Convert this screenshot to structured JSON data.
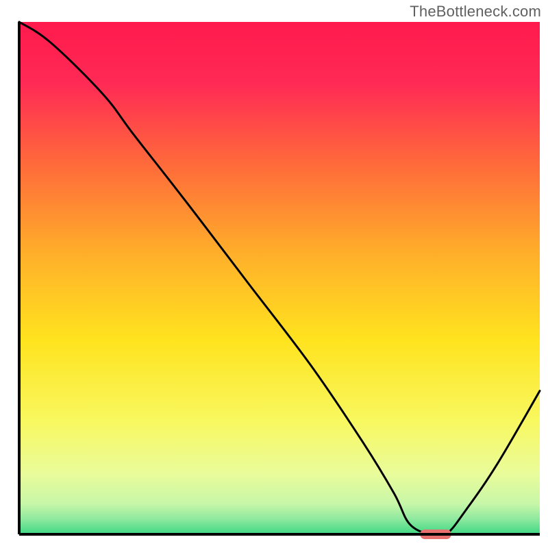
{
  "watermark": "TheBottleneck.com",
  "chart_data": {
    "type": "line",
    "title": "",
    "xlabel": "",
    "ylabel": "",
    "xlim": [
      0,
      100
    ],
    "ylim": [
      0,
      100
    ],
    "grid": false,
    "background_gradient": {
      "stops": [
        {
          "offset": 0.0,
          "color": "#ff1a4d"
        },
        {
          "offset": 0.12,
          "color": "#ff2a55"
        },
        {
          "offset": 0.28,
          "color": "#ff6b3a"
        },
        {
          "offset": 0.45,
          "color": "#ffae2a"
        },
        {
          "offset": 0.62,
          "color": "#ffe31e"
        },
        {
          "offset": 0.78,
          "color": "#f8f860"
        },
        {
          "offset": 0.88,
          "color": "#eafc9a"
        },
        {
          "offset": 0.94,
          "color": "#c8f7a8"
        },
        {
          "offset": 0.97,
          "color": "#8ee99f"
        },
        {
          "offset": 1.0,
          "color": "#3fd884"
        }
      ]
    },
    "series": [
      {
        "name": "bottleneck-curve",
        "color": "#000000",
        "x": [
          0,
          6,
          16,
          22,
          32,
          44,
          56,
          66,
          72,
          75,
          79,
          82,
          86,
          92,
          100
        ],
        "values": [
          100,
          96,
          86,
          78,
          65,
          49,
          33,
          18,
          8,
          2,
          0,
          0,
          5,
          14,
          28
        ]
      }
    ],
    "marker": {
      "name": "optimal-range",
      "color": "#e8716f",
      "x_start": 77,
      "x_end": 83,
      "y": 0,
      "thickness": 2
    },
    "axes": {
      "left": {
        "visible": true,
        "color": "#000000"
      },
      "bottom": {
        "visible": true,
        "color": "#000000"
      }
    }
  }
}
